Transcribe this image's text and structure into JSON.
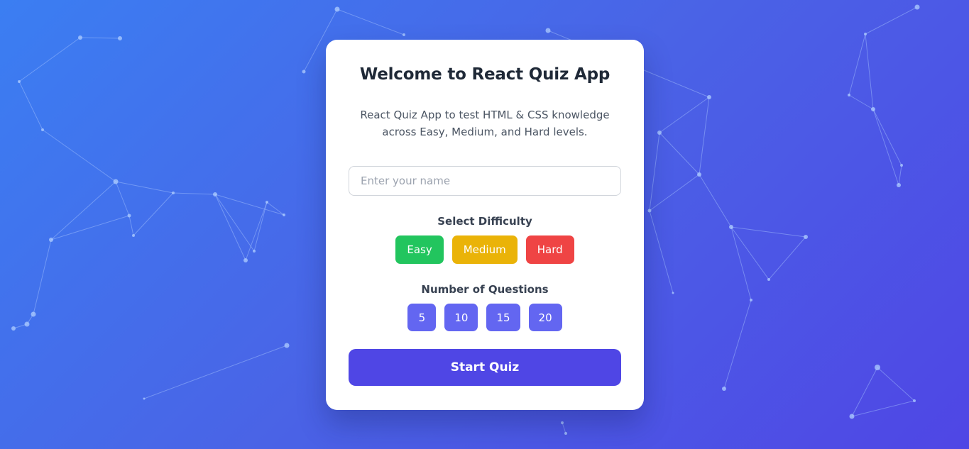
{
  "quiz": {
    "title": "Welcome to React Quiz App",
    "description": "React Quiz App to test HTML & CSS knowledge across Easy, Medium, and Hard levels.",
    "name_input": {
      "value": "",
      "placeholder": "Enter your name"
    },
    "difficulty": {
      "label": "Select Difficulty",
      "options": [
        {
          "label": "Easy",
          "color": "#22c55e"
        },
        {
          "label": "Medium",
          "color": "#eab308"
        },
        {
          "label": "Hard",
          "color": "#ef4444"
        }
      ]
    },
    "questions": {
      "label": "Number of Questions",
      "options": [
        "5",
        "10",
        "15",
        "20"
      ]
    },
    "start_label": "Start Quiz"
  },
  "colors": {
    "background_start": "#3b7ef2",
    "background_end": "#4f46e5",
    "accent": "#4f46e5",
    "count_button": "#6366f1"
  }
}
